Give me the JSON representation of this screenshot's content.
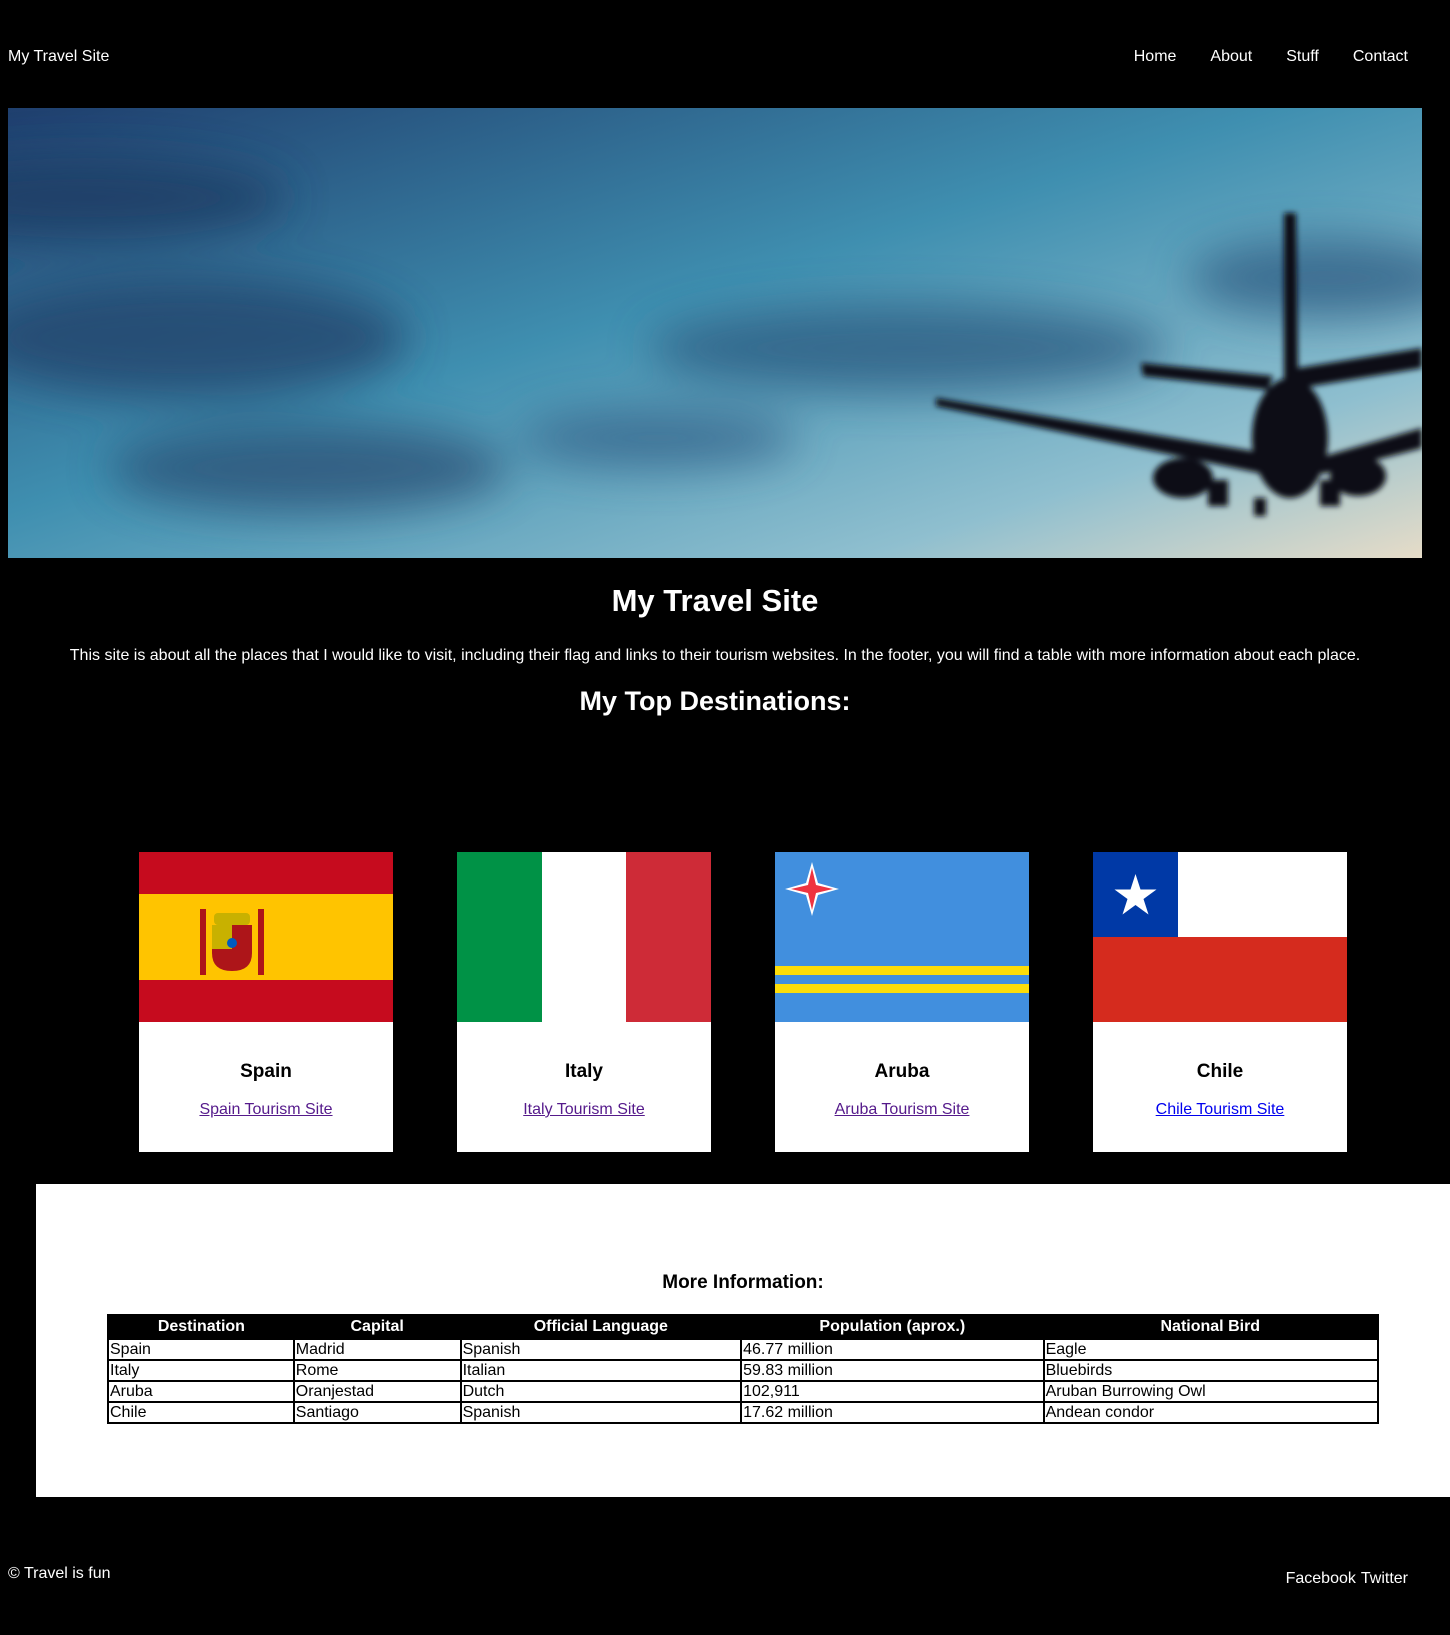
{
  "header": {
    "brand": "My Travel Site",
    "nav": [
      "Home",
      "About",
      "Stuff",
      "Contact"
    ]
  },
  "hero": {
    "icon": "airplane-silhouette"
  },
  "main": {
    "title": "My Travel Site",
    "intro": "This site is about all the places that I would like to visit, including their flag and links to their tourism websites. In the footer, you will find a table with more information about each place.",
    "destinations_title": "My Top Destinations:"
  },
  "cards": [
    {
      "name": "Spain",
      "link": "Spain Tourism Site",
      "flag_icon": "spain-flag"
    },
    {
      "name": "Italy",
      "link": "Italy Tourism Site",
      "flag_icon": "italy-flag"
    },
    {
      "name": "Aruba",
      "link": "Aruba Tourism Site",
      "flag_icon": "aruba-flag"
    },
    {
      "name": "Chile",
      "link": "Chile Tourism Site",
      "flag_icon": "chile-flag"
    }
  ],
  "info": {
    "title": "More Information:",
    "columns": [
      "Destination",
      "Capital",
      "Official Language",
      "Population (aprox.)",
      "National Bird"
    ],
    "rows": [
      [
        "Spain",
        "Madrid",
        "Spanish",
        "46.77 million",
        "Eagle"
      ],
      [
        "Italy",
        "Rome",
        "Italian",
        "59.83 million",
        "Bluebirds"
      ],
      [
        "Aruba",
        "Oranjestad",
        "Dutch",
        "102,911",
        "Aruban Burrowing Owl"
      ],
      [
        "Chile",
        "Santiago",
        "Spanish",
        "17.62 million",
        "Andean condor"
      ]
    ]
  },
  "footer": {
    "copyright": "© Travel is fun",
    "social": [
      "Facebook",
      "Twitter"
    ]
  },
  "colors": {
    "background": "#000000",
    "visited_link": "#551a8b",
    "link": "#0000ee"
  }
}
